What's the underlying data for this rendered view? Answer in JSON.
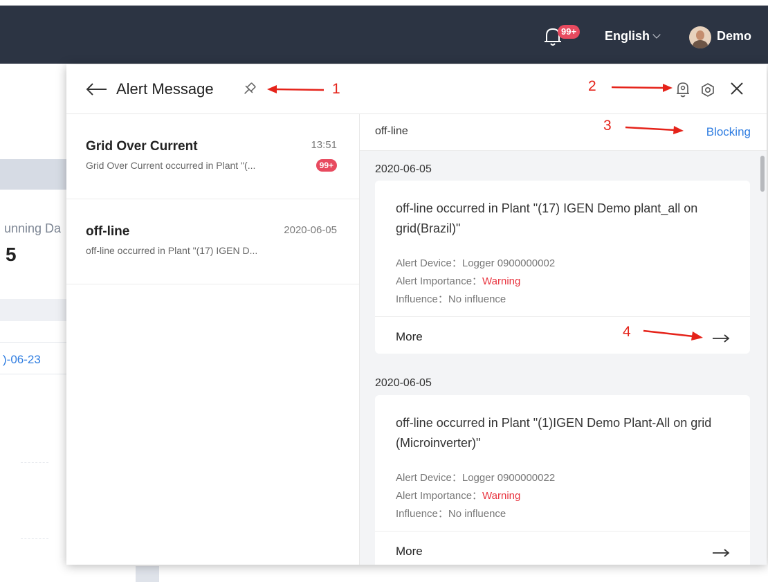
{
  "topbar": {
    "notification_badge": "99+",
    "language": "English",
    "user_name": "Demo"
  },
  "background_page": {
    "running_label": "unning Da",
    "running_value": "5",
    "date_link": ")-06-23"
  },
  "modal": {
    "title": "Alert Message",
    "alert_list": [
      {
        "title": "Grid Over Current",
        "time": "13:51",
        "description": "Grid Over Current occurred in Plant \"(...",
        "badge": "99+"
      },
      {
        "title": "off-line",
        "time": "2020-06-05",
        "description": "off-line occurred in Plant \"(17) IGEN D...",
        "badge": ""
      }
    ],
    "detail": {
      "alert_name": "off-line",
      "blocking_label": "Blocking",
      "entries": [
        {
          "date": "2020-06-05",
          "message": "off-line occurred in Plant \"(17) IGEN Demo plant_all on grid(Brazil)\"",
          "device_label": "Alert Device：",
          "device_value": "Logger 0900000002",
          "importance_label": "Alert Importance：",
          "importance_value": "Warning",
          "influence_label": "Influence：",
          "influence_value": "No influence",
          "more_label": "More"
        },
        {
          "date": "2020-06-05",
          "message": "off-line occurred in Plant \"(1)IGEN Demo Plant-All on grid (Microinverter)\"",
          "device_label": "Alert Device：",
          "device_value": "Logger 0900000022",
          "importance_label": "Alert Importance：",
          "importance_value": "Warning",
          "influence_label": "Influence：",
          "influence_value": "No influence",
          "more_label": "More"
        }
      ]
    }
  },
  "annotations": [
    "1",
    "2",
    "3",
    "4"
  ],
  "colors": {
    "topbar_bg": "#2c3443",
    "badge_red": "#e84a5f",
    "link_blue": "#2f7de1",
    "warning_red": "#e8343f",
    "annotation_red": "#e5231a"
  },
  "icons": [
    "bell-icon",
    "chevron-down-icon",
    "back-arrow-icon",
    "pin-icon",
    "alert-settings-bell-icon",
    "settings-icon",
    "close-icon",
    "more-arrow-icon"
  ]
}
